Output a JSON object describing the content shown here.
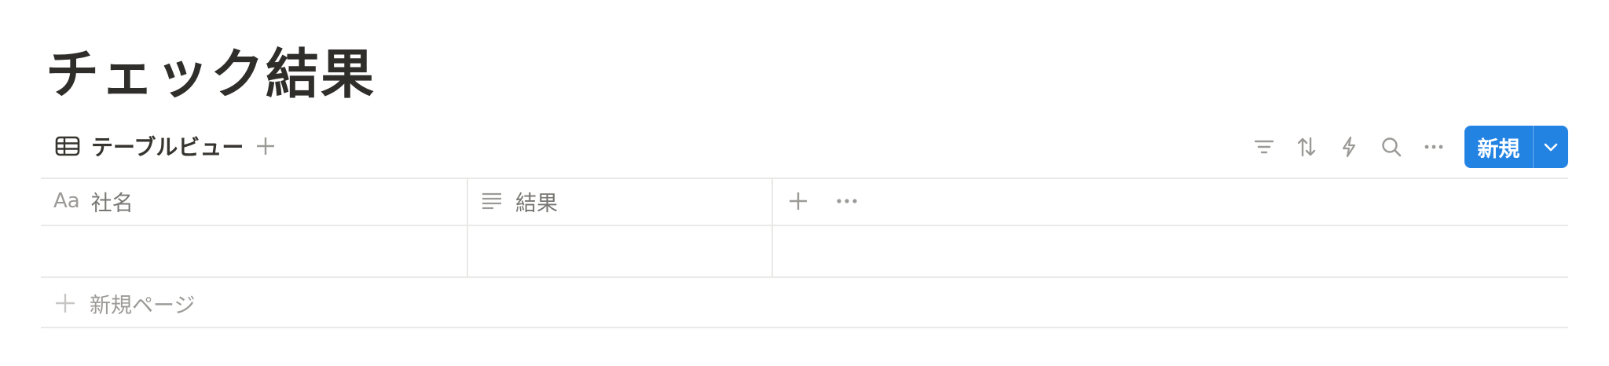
{
  "page": {
    "title": "チェック結果"
  },
  "view": {
    "tab_label": "テーブルビュー",
    "tab_icon": "table-icon",
    "add_icon": "plus-icon"
  },
  "toolbar": {
    "tools": [
      "filter-icon",
      "sort-icon",
      "automation-bolt-icon",
      "search-icon",
      "more-icon"
    ],
    "new_label": "新規",
    "new_dropdown_icon": "chevron-down-icon",
    "accent": "#2383e2"
  },
  "table": {
    "columns": [
      {
        "icon_text": "Aa",
        "label": "社名",
        "type": "title"
      },
      {
        "icon_text": "≡",
        "label": "結果",
        "type": "text"
      }
    ],
    "rows": [
      [
        "",
        ""
      ]
    ],
    "new_page_label": "新規ページ"
  }
}
